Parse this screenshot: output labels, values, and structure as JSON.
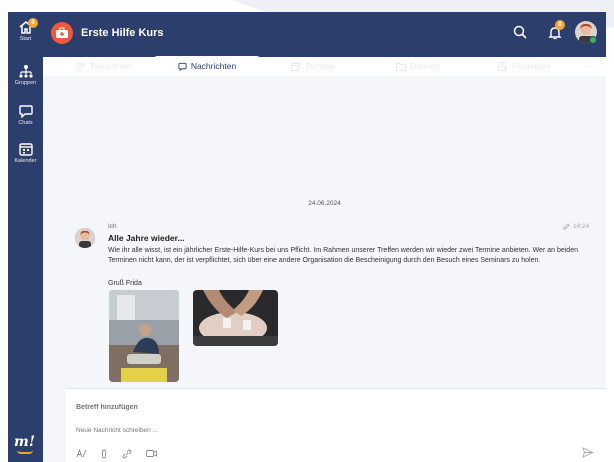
{
  "sidebar": {
    "items": [
      {
        "label": "Start",
        "icon": "home-icon",
        "badge": "8"
      },
      {
        "label": "Gruppen",
        "icon": "groups-icon"
      },
      {
        "label": "Chats",
        "icon": "chat-icon"
      },
      {
        "label": "Kalender",
        "icon": "calendar-icon"
      }
    ],
    "logo": "m!"
  },
  "header": {
    "group_title": "Erste Hilfe Kurs",
    "notification_badge": "8"
  },
  "tabs": [
    {
      "label": "Teilnehmer",
      "icon": "people-icon"
    },
    {
      "label": "Nachrichten",
      "icon": "chat-icon",
      "active": true
    },
    {
      "label": "Termine",
      "icon": "calendar-plus-icon"
    },
    {
      "label": "Dateien",
      "icon": "folder-icon"
    },
    {
      "label": "Formulare",
      "icon": "form-icon"
    },
    {
      "label": "···",
      "icon": "more-icon"
    }
  ],
  "messages": {
    "date_separator": "24.06.2024",
    "item": {
      "sender": "Ich",
      "time": "14:24",
      "subject": "Alle Jahre wieder...",
      "body": "Wie ihr alle wisst, ist ein jährlicher Erste-Hilfe-Kurs bei uns Pflicht. Im Rahmen unserer Treffen werden wir wieder zwei Termine anbieten. Wer an beiden Terminen nicht kann, der ist verpflichtet, sich über eine andere Organisation die Bescheinigung durch den Besuch eines Seminars zu holen.",
      "signature": "Gruß Frida"
    }
  },
  "compose": {
    "subject_placeholder": "Betreff hinzufügen",
    "body_placeholder": "Neue Nachricht schreiben ..."
  },
  "colors": {
    "brand_navy": "#2c3e6b",
    "accent_orange": "#f3a43b",
    "group_avatar": "#f05a3c",
    "online": "#3cb55a"
  }
}
